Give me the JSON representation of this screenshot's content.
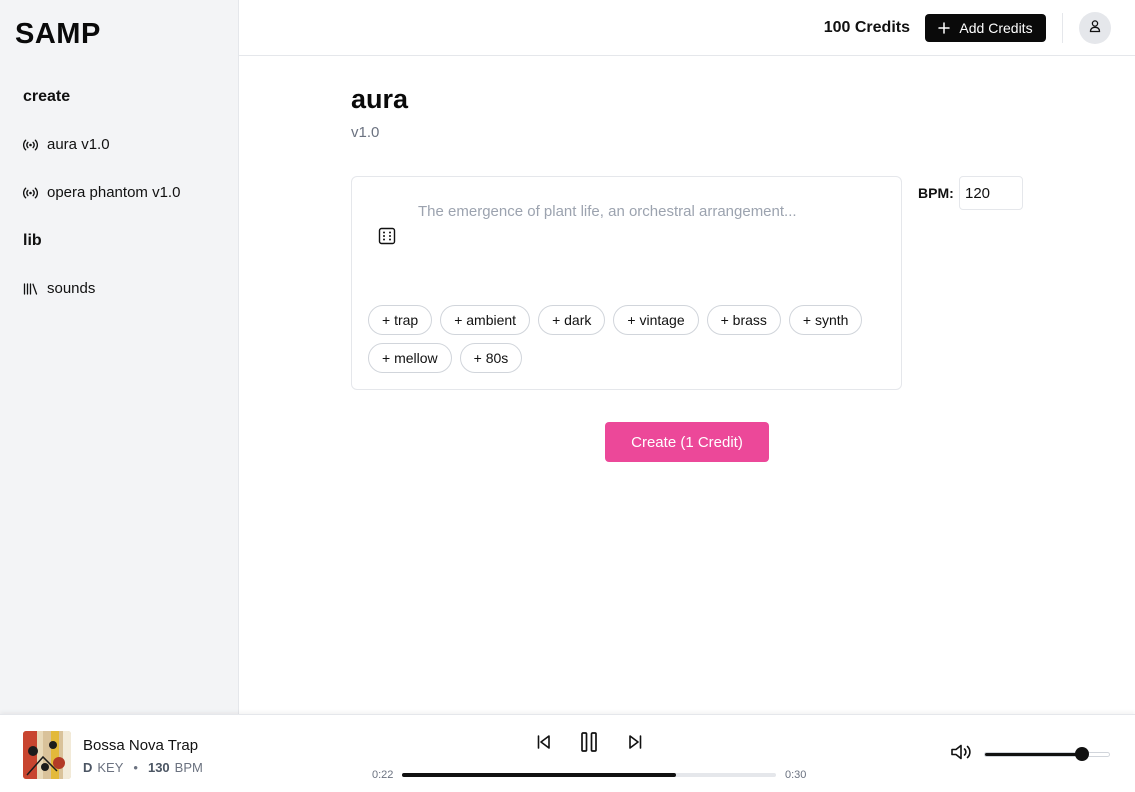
{
  "app": {
    "logo": "SAMP"
  },
  "sidebar": {
    "sections": [
      {
        "heading": "create",
        "items": [
          {
            "label": "aura v1.0",
            "icon": "radio-icon"
          },
          {
            "label": "opera phantom v1.0",
            "icon": "radio-icon"
          }
        ]
      },
      {
        "heading": "lib",
        "items": [
          {
            "label": "sounds",
            "icon": "library-icon"
          }
        ]
      }
    ]
  },
  "header": {
    "credits": "100 Credits",
    "add_credits_label": "Add Credits",
    "avatar_icon": "user-icon"
  },
  "main": {
    "title": "aura",
    "subtitle": "v1.0",
    "prompt": {
      "value": "",
      "placeholder": "The emergence of plant life, an orchestral arrangement..."
    },
    "tags": [
      "+ trap",
      "+ ambient",
      "+ dark",
      "+ vintage",
      "+ brass",
      "+ synth",
      "+ mellow",
      "+ 80s"
    ],
    "bpm": {
      "label": "BPM:",
      "value": "120"
    },
    "create_label": "Create (1 Credit)"
  },
  "player": {
    "title": "Bossa Nova Trap",
    "key_value": "D",
    "key_label": "KEY",
    "separator": "•",
    "bpm_value": "130",
    "bpm_label": "BPM",
    "current_time": "0:22",
    "total_time": "0:30",
    "progress": 0.733,
    "volume": 0.78,
    "state": "playing"
  },
  "colors": {
    "accent": "#ec4899",
    "dark": "#0a0a0a",
    "sidebar_bg": "#f3f4f6",
    "muted_text": "#6b7280"
  }
}
